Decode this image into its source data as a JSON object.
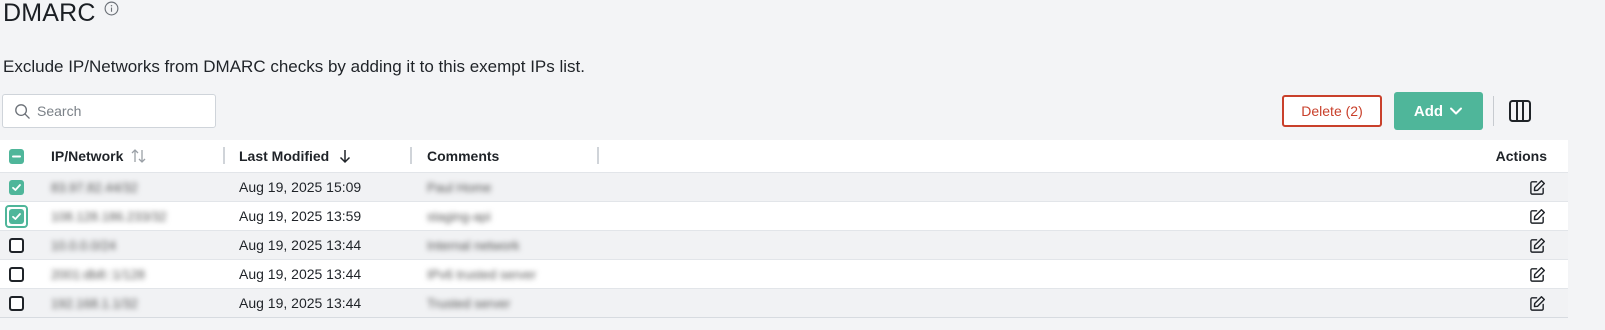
{
  "page": {
    "title": "DMARC",
    "description": "Exclude IP/Networks from DMARC checks by adding it to this exempt IPs list."
  },
  "toolbar": {
    "search_placeholder": "Search",
    "search_value": "",
    "delete_label": "Delete (2)",
    "add_label": "Add",
    "accent_color": "#4fb69a",
    "danger_color": "#c9402b"
  },
  "table": {
    "columns": {
      "ip": "IP/Network",
      "modified": "Last Modified",
      "comments": "Comments",
      "actions": "Actions"
    },
    "select_all_state": "indeterminate",
    "rows": [
      {
        "ip": "83.97.82.44/32",
        "modified": "Aug 19, 2025 15:09",
        "comment": "Paul Home",
        "checked": true,
        "focused": false
      },
      {
        "ip": "108.128.186.233/32",
        "modified": "Aug 19, 2025 13:59",
        "comment": "staging-api",
        "checked": true,
        "focused": true
      },
      {
        "ip": "10.0.0.0/24",
        "modified": "Aug 19, 2025 13:44",
        "comment": "Internal network",
        "checked": false,
        "focused": false
      },
      {
        "ip": "2001:db8::1/128",
        "modified": "Aug 19, 2025 13:44",
        "comment": "IPv6 trusted server",
        "checked": false,
        "focused": false
      },
      {
        "ip": "192.168.1.1/32",
        "modified": "Aug 19, 2025 13:44",
        "comment": "Trusted server",
        "checked": false,
        "focused": false
      }
    ]
  }
}
